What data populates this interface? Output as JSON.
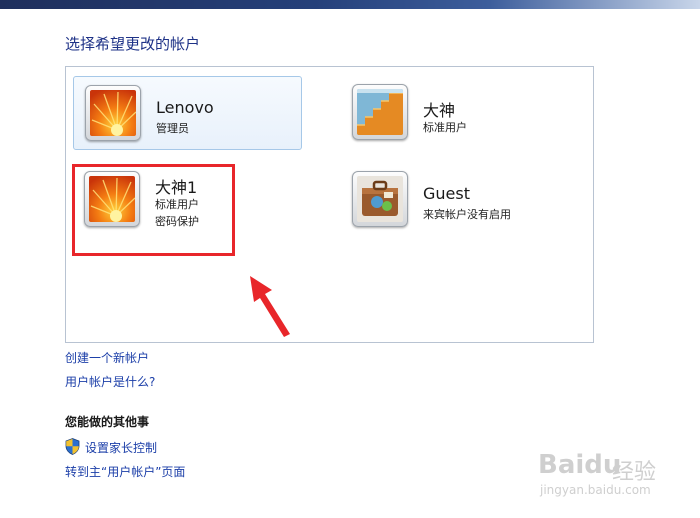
{
  "page_title": "选择希望更改的帐户",
  "accounts": [
    {
      "name": "Lenovo",
      "line1": "管理员",
      "line2": "",
      "picture": "orange-flower-icon",
      "selected": true
    },
    {
      "name": "大神",
      "line1": "标准用户",
      "line2": "",
      "picture": "stairs-icon",
      "selected": false
    },
    {
      "name": "大神1",
      "line1": "标准用户",
      "line2": "密码保护",
      "picture": "orange-flower-icon",
      "selected": false
    },
    {
      "name": "Guest",
      "line1": "来宾帐户没有启用",
      "line2": "",
      "picture": "suitcase-icon",
      "selected": false
    }
  ],
  "links": {
    "create_account": "创建一个新帐户",
    "what_is_account": "用户帐户是什么?"
  },
  "other_tasks": {
    "heading": "您能做的其他事",
    "parental_control": "设置家长控制",
    "go_main": "转到主“用户帐户”页面"
  },
  "watermark": {
    "logo": "Baidu",
    "jingyan": "经验",
    "url": "jingyan.baidu.com"
  },
  "colors": {
    "link": "#1b3ea8",
    "title": "#1e3287",
    "highlight": "#e8262a",
    "arrow": "#e8262a"
  }
}
